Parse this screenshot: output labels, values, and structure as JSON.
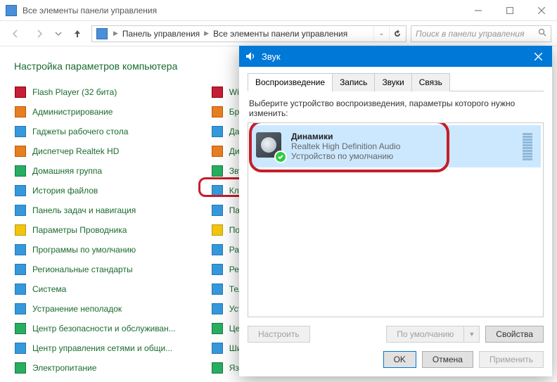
{
  "window": {
    "title": "Все элементы панели управления",
    "breadcrumb": {
      "seg1": "Панель управления",
      "seg2": "Все элементы панели управления"
    },
    "search_placeholder": "Поиск в панели управления"
  },
  "page_title": "Настройка параметров компьютера",
  "items_col1": [
    "Flash Player (32 бита)",
    "Администрирование",
    "Гаджеты рабочего стола",
    "Диспетчер Realtek HD",
    "Домашняя группа",
    "История файлов",
    "Панель задач и навигация",
    "Параметры Проводника",
    "Программы по умолчанию",
    "Региональные стандарты",
    "Система",
    "Устранение неполадок",
    "Центр безопасности и обслуживан...",
    "Центр управления сетями и общи...",
    "Электропитание"
  ],
  "items_col2": [
    "Window",
    "Брандм",
    "Дата и",
    "Диспет",
    "Звук",
    "Клавиа",
    "Панель",
    "Подкл",
    "Рабочи",
    "Резерв",
    "Телефо",
    "Устрой",
    "Центр",
    "Шифро",
    "Язык"
  ],
  "dialog": {
    "title": "Звук",
    "tabs": [
      "Воспроизведение",
      "Запись",
      "Звуки",
      "Связь"
    ],
    "desc": "Выберите устройство воспроизведения, параметры которого нужно изменить:",
    "device": {
      "name": "Динамики",
      "driver": "Realtek High Definition Audio",
      "status": "Устройство по умолчанию"
    },
    "buttons": {
      "configure": "Настроить",
      "default": "По умолчанию",
      "properties": "Свойства",
      "ok": "OK",
      "cancel": "Отмена",
      "apply": "Применить"
    }
  }
}
